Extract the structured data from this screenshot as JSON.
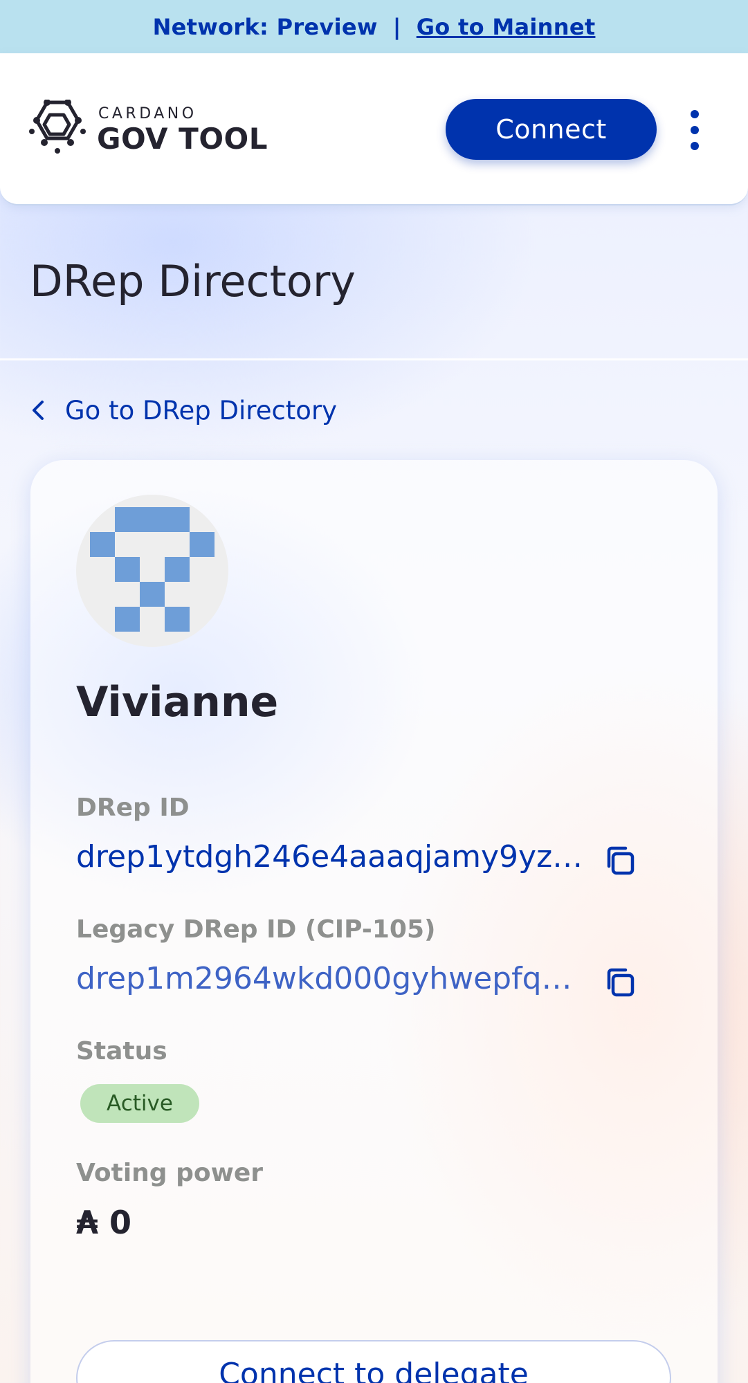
{
  "banner": {
    "network_text": "Network: Preview",
    "separator": "|",
    "mainnet_link": "Go to Mainnet"
  },
  "header": {
    "logo_small": "CARDANO",
    "logo_big": "GOV TOOL",
    "connect_label": "Connect",
    "menu_icon": "more-vertical-icon"
  },
  "page": {
    "title": "DRep Directory",
    "back_label": "Go to DRep Directory"
  },
  "drep": {
    "name": "Vivianne",
    "id_label": "DRep ID",
    "id_value": "drep1ytdgh246e4aaaqjamy9yz…",
    "legacy_label": "Legacy DRep ID (CIP-105)",
    "legacy_value": "drep1m2964wkd000gyhwepfqk…",
    "status_label": "Status",
    "status_value": "Active",
    "voting_power_label": "Voting power",
    "voting_power_value": "₳ 0",
    "delegate_label": "Connect to delegate"
  },
  "colors": {
    "primary": "#0033ad",
    "banner_bg": "#b9e1ef",
    "status_bg": "#c0e4ba",
    "status_text": "#285a24",
    "avatar_color": "#6e9ed8"
  }
}
